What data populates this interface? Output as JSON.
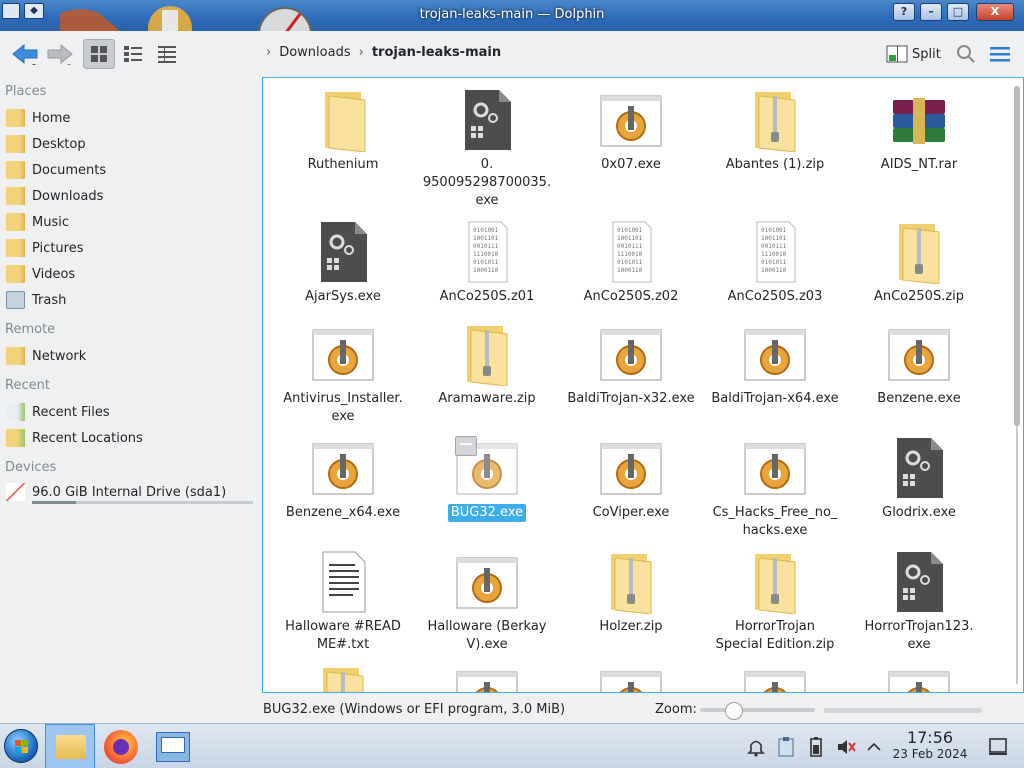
{
  "window": {
    "title": "trojan-leaks-main — Dolphin",
    "controls": {
      "help": "?",
      "minimize": "–",
      "maximize": "□",
      "close": "X"
    }
  },
  "toolbar": {
    "breadcrumb": [
      "Downloads",
      "trojan-leaks-main"
    ],
    "split_label": "Split"
  },
  "sidebar": {
    "sections": [
      {
        "title": "Places",
        "items": [
          "Home",
          "Desktop",
          "Documents",
          "Downloads",
          "Music",
          "Pictures",
          "Videos",
          "Trash"
        ]
      },
      {
        "title": "Remote",
        "items": [
          "Network"
        ]
      },
      {
        "title": "Recent",
        "items": [
          "Recent Files",
          "Recent Locations"
        ]
      },
      {
        "title": "Devices",
        "items": [
          "96.0 GiB Internal Drive (sda1)"
        ]
      }
    ],
    "drive_usage_fraction": 0.2
  },
  "files": [
    {
      "name": "Ruthenium",
      "type": "folder"
    },
    {
      "name": "0.\n950095298700035.\nexe",
      "type": "exe-dark"
    },
    {
      "name": "0x07.exe",
      "type": "exe"
    },
    {
      "name": "Abantes (1).zip",
      "type": "zip"
    },
    {
      "name": "AIDS_NT.rar",
      "type": "rar"
    },
    {
      "name": "AjarSys.exe",
      "type": "exe-dark"
    },
    {
      "name": "AnCo250S.z01",
      "type": "binary"
    },
    {
      "name": "AnCo250S.z02",
      "type": "binary"
    },
    {
      "name": "AnCo250S.z03",
      "type": "binary"
    },
    {
      "name": "AnCo250S.zip",
      "type": "zip"
    },
    {
      "name": "Antivirus_Installer.\nexe",
      "type": "exe"
    },
    {
      "name": "Aramaware.zip",
      "type": "zip"
    },
    {
      "name": "BaldiTrojan-x32.exe",
      "type": "exe"
    },
    {
      "name": "BaldiTrojan-x64.exe",
      "type": "exe"
    },
    {
      "name": "Benzene.exe",
      "type": "exe"
    },
    {
      "name": "Benzene_x64.exe",
      "type": "exe"
    },
    {
      "name": "BUG32.exe",
      "type": "exe",
      "selected": true
    },
    {
      "name": "CoViper.exe",
      "type": "exe"
    },
    {
      "name": "Cs_Hacks_Free_no_\nhacks.exe",
      "type": "exe"
    },
    {
      "name": "Glodrix.exe",
      "type": "exe-dark"
    },
    {
      "name": "Halloware #READ\nME#.txt",
      "type": "txt"
    },
    {
      "name": "Halloware (Berkay\nV).exe",
      "type": "exe"
    },
    {
      "name": "Holzer.zip",
      "type": "zip"
    },
    {
      "name": "HorrorTrojan\nSpecial Edition.zip",
      "type": "zip"
    },
    {
      "name": "HorrorTrojan123.\nexe",
      "type": "exe-dark"
    },
    {
      "name": "",
      "type": "zip"
    },
    {
      "name": "",
      "type": "exe"
    },
    {
      "name": "",
      "type": "exe"
    },
    {
      "name": "",
      "type": "exe"
    },
    {
      "name": "",
      "type": "exe"
    }
  ],
  "statusbar": {
    "info": "BUG32.exe (Windows or EFI program, 3.0 MiB)",
    "zoom_label": "Zoom:",
    "zoom_fraction": 0.1
  },
  "taskbar": {
    "time": "17:56",
    "date": "23 Feb 2024"
  },
  "colors": {
    "accent": "#3daee9",
    "titlebar": "#2e6bb8",
    "folder": "#f3d27a"
  }
}
